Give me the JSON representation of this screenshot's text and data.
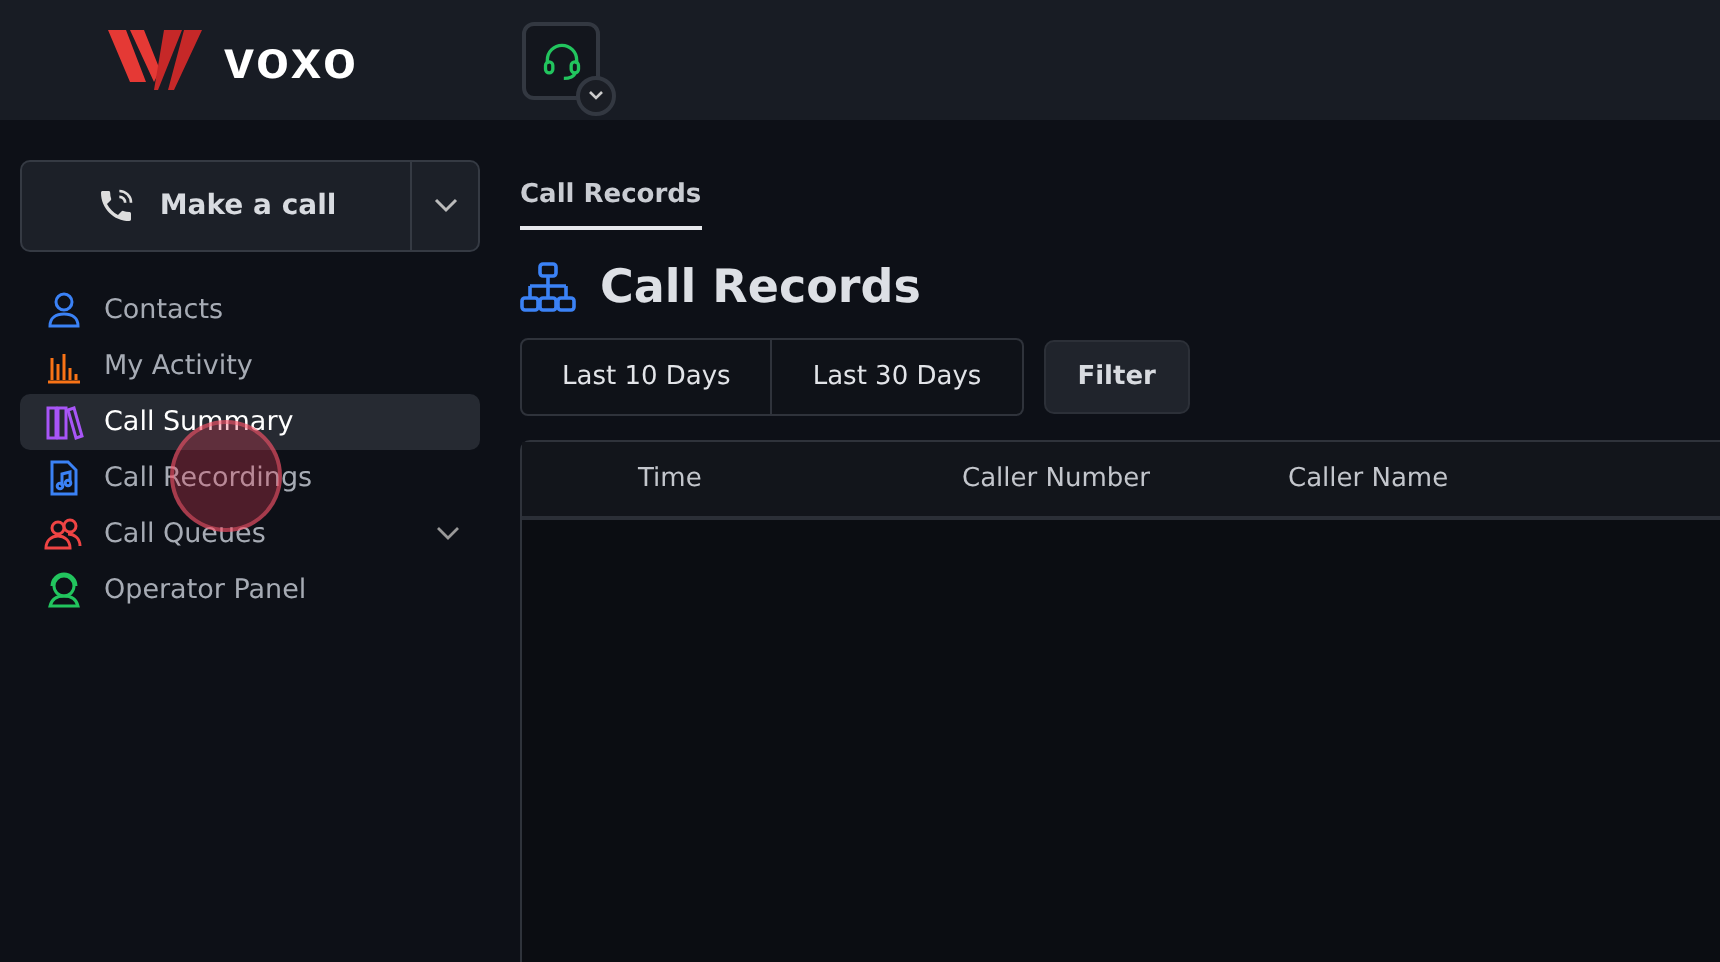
{
  "header": {
    "logo": "voxo",
    "status_button": {
      "expanded": false
    }
  },
  "sidebar": {
    "make_call": {
      "label": "Make a call"
    },
    "items": [
      {
        "label": "Contacts",
        "selected": false,
        "color": "#3b82f6"
      },
      {
        "label": "My Activity",
        "selected": false,
        "color": "#f97316"
      },
      {
        "label": "Call Summary",
        "selected": true,
        "color": "#a855f7"
      },
      {
        "label": "Call Recordings",
        "selected": false,
        "color": "#3b82f6"
      },
      {
        "label": "Call Queues",
        "selected": false,
        "color": "#ef4444",
        "expanded": false
      },
      {
        "label": "Operator Panel",
        "selected": false,
        "color": "#22c55e"
      }
    ]
  },
  "tabs": [
    {
      "label": "Call Records",
      "selected": true
    }
  ],
  "page_title": "Call Records",
  "range_buttons": [
    {
      "label": "Last 10 Days"
    },
    {
      "label": "Last 30 Days"
    }
  ],
  "filter_button": "Filter",
  "table": {
    "columns": [
      "Time",
      "Caller Number",
      "Caller Name"
    ]
  }
}
